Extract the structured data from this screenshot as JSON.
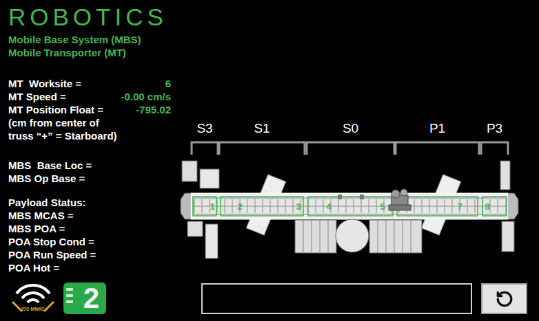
{
  "title": "ROBOTICS",
  "subtitles": [
    "Mobile Base System (MBS)",
    "Mobile Transporter (MT)"
  ],
  "mt_fields": [
    {
      "label": "MT  Worksite =",
      "value": "6"
    },
    {
      "label": "MT Speed =",
      "value": "-0.00 cm/s"
    },
    {
      "label": "MT Position Float =",
      "value": "-795.02"
    }
  ],
  "position_note": [
    "(cm from center of",
    "truss “+” = Starboard)"
  ],
  "mbs_fields": [
    {
      "label": "MBS  Base Loc =",
      "value": ""
    },
    {
      "label": "MBS Op Base =",
      "value": ""
    }
  ],
  "payload": {
    "heading": "Payload Status:",
    "fields": [
      {
        "label": "MBS MCAS =",
        "value": ""
      },
      {
        "label": "MBS POA =",
        "value": ""
      },
      {
        "label": "POA Stop Cond =",
        "value": ""
      },
      {
        "label": "POA Run Speed =",
        "value": ""
      },
      {
        "label": "POA Hot =",
        "value": ""
      }
    ]
  },
  "truss": {
    "segments": [
      {
        "label": "S3"
      },
      {
        "label": "S1"
      },
      {
        "label": "S0"
      },
      {
        "label": "P1"
      },
      {
        "label": "P3"
      }
    ],
    "worksites": [
      {
        "label": "1",
        "mt_present": false
      },
      {
        "label": "2",
        "mt_present": false
      },
      {
        "label": "3",
        "mt_present": false
      },
      {
        "label": "4",
        "mt_present": false
      },
      {
        "label": "5",
        "mt_present": false
      },
      {
        "label": "",
        "mt_present": true
      },
      {
        "label": "7",
        "mt_present": false
      },
      {
        "label": "8",
        "mt_present": false
      }
    ]
  },
  "logo": {
    "text": "ISS MIMIC"
  },
  "badge": "2",
  "message": ""
}
